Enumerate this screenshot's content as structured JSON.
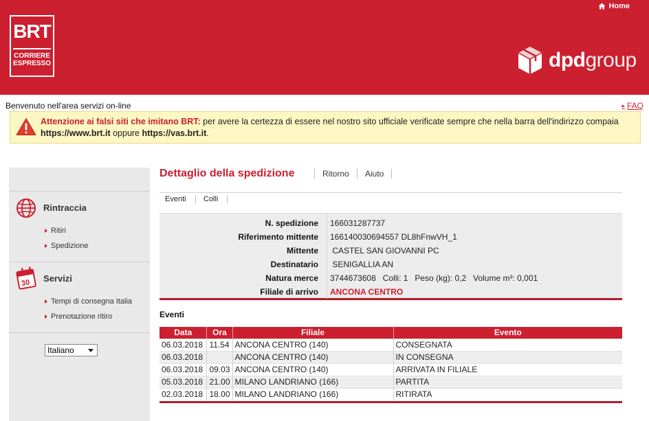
{
  "header": {
    "brand": "BRT",
    "brand_sub_1": "CORRIERE",
    "brand_sub_2": "ESPRESSO",
    "home_label": "Home",
    "dpd_bold": "dpd",
    "dpd_thin": "group",
    "bg_color": "#cc1f30"
  },
  "welcome": "Benvenuto  nell'area servizi on-line",
  "faq_label": "FAQ",
  "warning": {
    "title": "Attenzione ai falsi siti che imitano BRT:",
    "text_1": " per avere la certezza di essere nel nostro sito ufficiale verificate sempre che nella barra dell'indirizzo compaia ",
    "url_1": "https://www.brt.it",
    "text_2": " oppure ",
    "url_2": "https://vas.brt.it",
    "text_3": "."
  },
  "sidebar": {
    "sections": [
      {
        "title": "Rintraccia",
        "icon": "globe-icon",
        "links": [
          "Ritiri",
          "Spedizione"
        ]
      },
      {
        "title": "Servizi",
        "icon": "calendar-icon",
        "links": [
          "Tempi di consegna Italia",
          "Prenotazione ritiro"
        ]
      }
    ],
    "language": "Italiano"
  },
  "main": {
    "title": "Dettaglio della spedizione",
    "links": [
      "Ritorno",
      "Aiuto"
    ],
    "subtabs": [
      "Eventi",
      "Colli"
    ],
    "details": [
      {
        "label": "N. spedizione",
        "value": "166031287737"
      },
      {
        "label": "Riferimento mittente",
        "value": "166140030694557 DL8hFnwVH_1"
      },
      {
        "label": "Mittente",
        "value": " CASTEL SAN GIOVANNI PC"
      },
      {
        "label": "Destinatario",
        "value": " SENIGALLIA AN"
      },
      {
        "label": "Natura merce",
        "value": "3744673608   Colli: 1   Peso (kg): 0,2   Volume m³: 0,001"
      },
      {
        "label": "Filiale di arrivo",
        "value": "ANCONA CENTRO"
      }
    ],
    "events_heading": "Eventi",
    "events_columns": [
      "Data",
      "Ora",
      "Filiale",
      "Evento"
    ],
    "events_rows": [
      [
        "06.03.2018",
        "11.54",
        "ANCONA CENTRO (140)",
        "CONSEGNATA"
      ],
      [
        "06.03.2018",
        "",
        "ANCONA CENTRO (140)",
        "IN CONSEGNA"
      ],
      [
        "06.03.2018",
        "09.03",
        "ANCONA CENTRO (140)",
        "ARRIVATA IN FILIALE"
      ],
      [
        "05.03.2018",
        "21.00",
        "MILANO LANDRIANO (166)",
        "PARTITA"
      ],
      [
        "02.03.2018",
        "18.00",
        "MILANO LANDRIANO (166)",
        "RITIRATA"
      ]
    ]
  }
}
